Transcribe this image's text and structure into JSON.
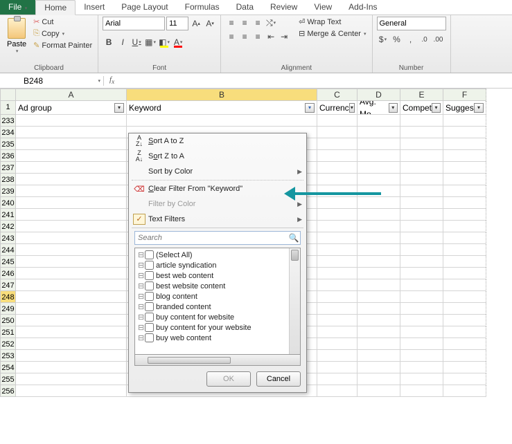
{
  "tabs": {
    "file": "File",
    "home": "Home",
    "insert": "Insert",
    "page_layout": "Page Layout",
    "formulas": "Formulas",
    "data": "Data",
    "review": "Review",
    "view": "View",
    "addins": "Add-Ins"
  },
  "clipboard": {
    "paste": "Paste",
    "cut": "Cut",
    "copy": "Copy",
    "format_painter": "Format Painter",
    "label": "Clipboard"
  },
  "font": {
    "name": "Arial",
    "size": "11",
    "label": "Font"
  },
  "alignment": {
    "wrap": "Wrap Text",
    "merge": "Merge & Center",
    "label": "Alignment"
  },
  "number": {
    "format": "General",
    "label": "Number"
  },
  "name_box": "B248",
  "columns": {
    "A": "A",
    "B": "B",
    "C": "C",
    "D": "D",
    "E": "E",
    "F": "F"
  },
  "headers": {
    "A": "Ad group",
    "B": "Keyword",
    "C": "Currenc",
    "D": "Avg. Mo",
    "E": "Compet",
    "F": "Sugges"
  },
  "rows_start": 233,
  "rows_end": 256,
  "selected_row": 248,
  "filter": {
    "sort_az": "Sort A to Z",
    "sort_za": "Sort Z to A",
    "sort_color": "Sort by Color",
    "clear": "Clear Filter From \"Keyword\"",
    "filter_color": "Filter by Color",
    "text_filters": "Text Filters",
    "search_placeholder": "Search",
    "ok": "OK",
    "cancel": "Cancel",
    "items": [
      "(Select All)",
      "article syndication",
      "best web content",
      "best website content",
      "blog content",
      "branded content",
      "buy content for website",
      "buy content for your website",
      "buy web content"
    ]
  }
}
